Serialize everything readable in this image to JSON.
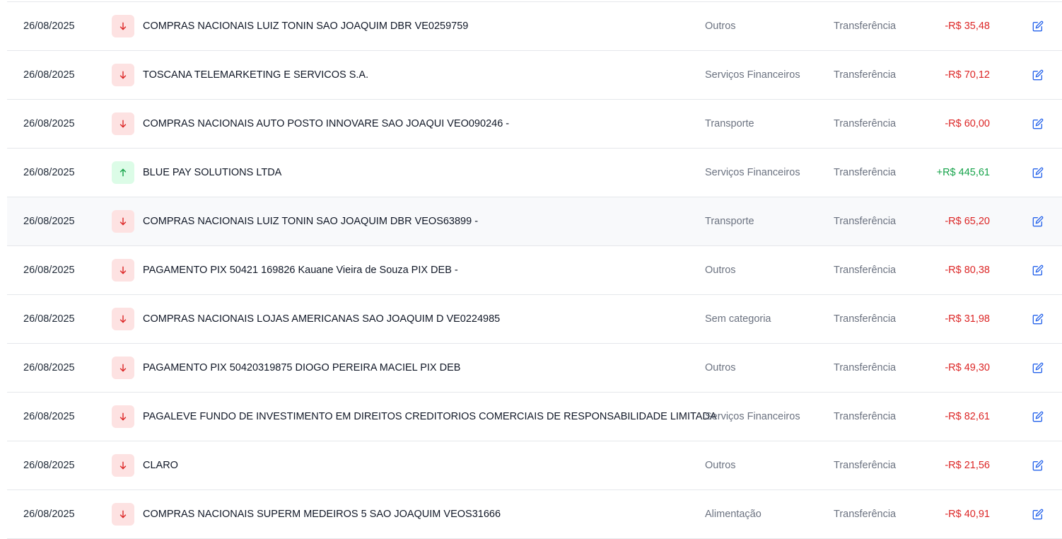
{
  "colors": {
    "negative": "#dc2626",
    "positive": "#16a34a",
    "edit": "#2563eb"
  },
  "transactions": [
    {
      "date": "26/08/2025",
      "direction": "out",
      "description": "COMPRAS NACIONAIS LUIZ TONIN SAO JOAQUIM DBR VE0259759",
      "category": "Outros",
      "type": "Transferência",
      "amount": "-R$ 35,48"
    },
    {
      "date": "26/08/2025",
      "direction": "out",
      "description": "TOSCANA TELEMARKETING E SERVICOS S.A.",
      "category": "Serviços Financeiros",
      "type": "Transferência",
      "amount": "-R$ 70,12"
    },
    {
      "date": "26/08/2025",
      "direction": "out",
      "description": "COMPRAS NACIONAIS AUTO POSTO INNOVARE SAO JOAQUI VEO090246 -",
      "category": "Transporte",
      "type": "Transferência",
      "amount": "-R$ 60,00"
    },
    {
      "date": "26/08/2025",
      "direction": "in",
      "description": "BLUE PAY SOLUTIONS LTDA",
      "category": "Serviços Financeiros",
      "type": "Transferência",
      "amount": "+R$ 445,61"
    },
    {
      "date": "26/08/2025",
      "direction": "out",
      "description": "COMPRAS NACIONAIS LUIZ TONIN SAO JOAQUIM DBR VEOS63899 -",
      "category": "Transporte",
      "type": "Transferência",
      "amount": "-R$ 65,20",
      "hovered": true
    },
    {
      "date": "26/08/2025",
      "direction": "out",
      "description": "PAGAMENTO PIX 50421 169826 Kauane Vieira de Souza PIX DEB -",
      "category": "Outros",
      "type": "Transferência",
      "amount": "-R$ 80,38"
    },
    {
      "date": "26/08/2025",
      "direction": "out",
      "description": "COMPRAS NACIONAIS LOJAS AMERICANAS SAO JOAQUIM D VE0224985",
      "category": "Sem categoria",
      "type": "Transferência",
      "amount": "-R$ 31,98"
    },
    {
      "date": "26/08/2025",
      "direction": "out",
      "description": "PAGAMENTO PIX 50420319875 DIOGO PEREIRA MACIEL PIX DEB",
      "category": "Outros",
      "type": "Transferência",
      "amount": "-R$ 49,30"
    },
    {
      "date": "26/08/2025",
      "direction": "out",
      "description": "PAGALEVE FUNDO DE INVESTIMENTO EM DIREITOS CREDITORIOS COMERCIAIS DE RESPONSABILIDADE LIMITADA",
      "category": "Serviços Financeiros",
      "type": "Transferência",
      "amount": "-R$ 82,61"
    },
    {
      "date": "26/08/2025",
      "direction": "out",
      "description": "CLARO",
      "category": "Outros",
      "type": "Transferência",
      "amount": "-R$ 21,56"
    },
    {
      "date": "26/08/2025",
      "direction": "out",
      "description": "COMPRAS NACIONAIS SUPERM MEDEIROS 5 SAO JOAQUIM VEOS31666",
      "category": "Alimentação",
      "type": "Transferência",
      "amount": "-R$ 40,91"
    }
  ]
}
